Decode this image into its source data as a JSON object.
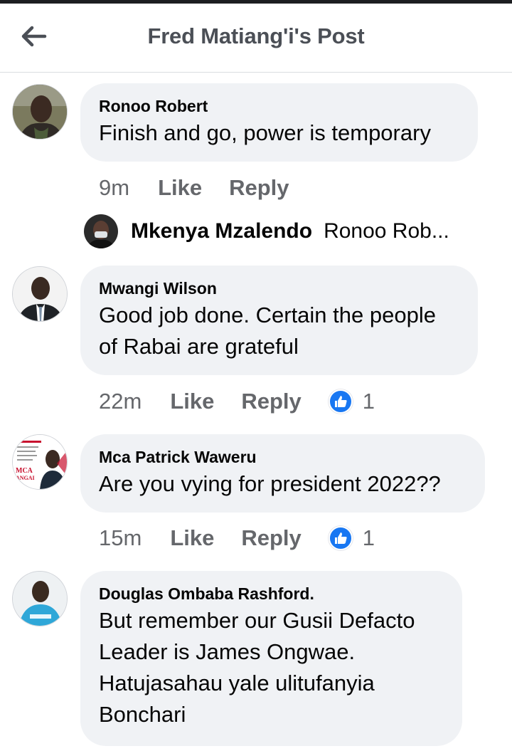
{
  "header": {
    "title": "Fred Matiang'i's Post"
  },
  "comments": [
    {
      "author": "Ronoo Robert",
      "text": "Finish and go, power is temporary",
      "time": "9m",
      "like": "Like",
      "reply": "Reply"
    },
    {
      "author": "Mwangi Wilson",
      "text_lines": [
        "Good job done. Certain the people",
        "of Rabai are grateful"
      ],
      "time": "22m",
      "like": "Like",
      "reply": "Reply",
      "reaction_count": "1"
    },
    {
      "author": "Mca Patrick Waweru",
      "text": "Are you vying for president 2022??",
      "time": "15m",
      "like": "Like",
      "reply": "Reply",
      "reaction_count": "1"
    },
    {
      "author": "Douglas Ombaba Rashford.",
      "text_lines": [
        "But remember our Gusii Defacto",
        "Leader is James Ongwae.",
        "Hatujasahau yale ulitufanyia",
        "Bonchari"
      ]
    }
  ],
  "reply_preview": {
    "name": "Mkenya Mzalendo",
    "snippet": "Ronoo Rob..."
  },
  "avatar_badge": {
    "line1": "MCA",
    "line2": "ANGAI"
  },
  "colors": {
    "bubble": "#f0f2f5",
    "muted": "#65676b",
    "like_blue": "#1877f2"
  }
}
